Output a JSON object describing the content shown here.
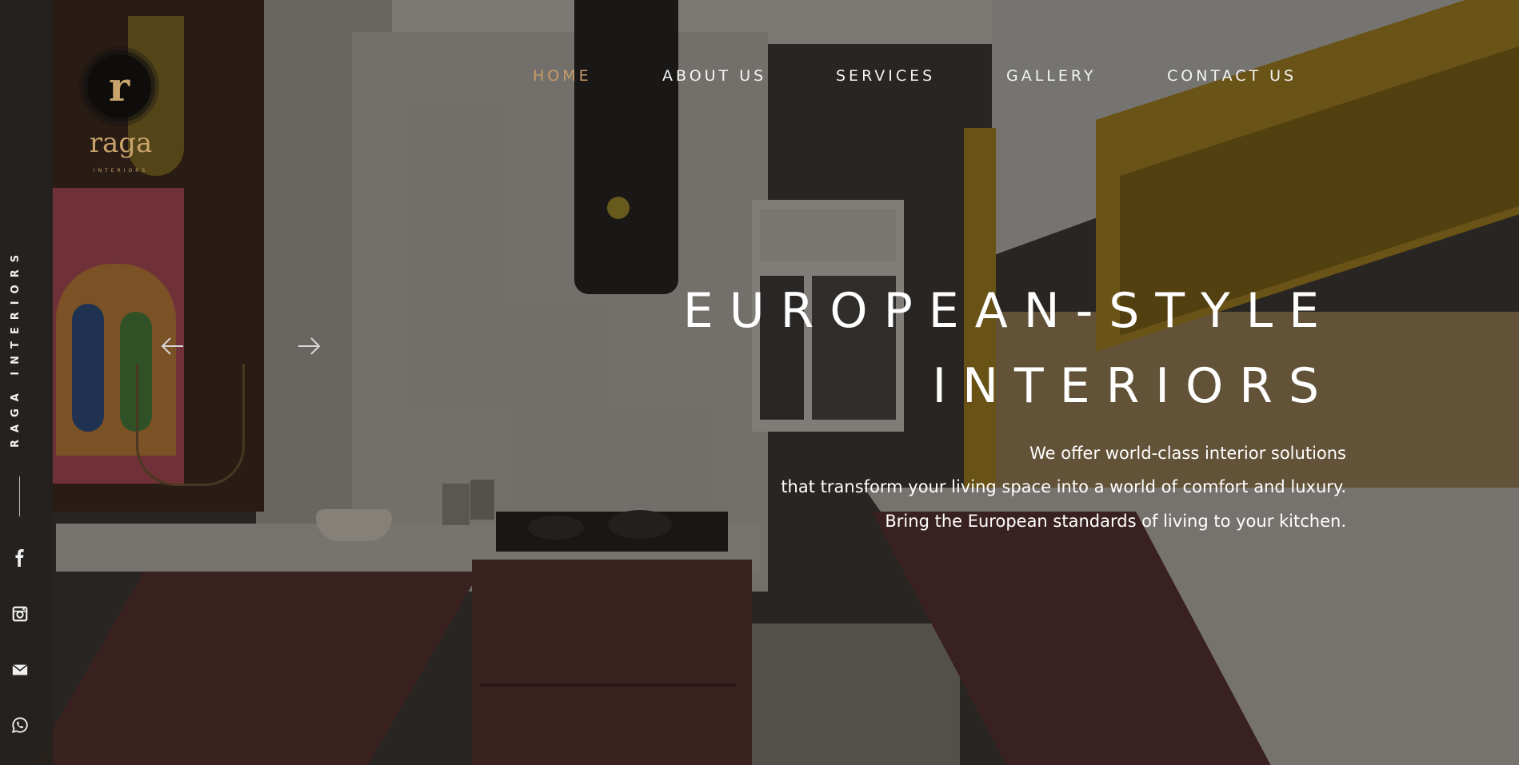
{
  "brand": {
    "logo_letter": "r",
    "logo_name": "raga",
    "logo_sub": "INTERIORS",
    "vertical_text": "RAGA INTERIORS",
    "accent_color": "#c59a6b"
  },
  "nav": {
    "items": [
      {
        "label": "HOME",
        "active": true
      },
      {
        "label": "ABOUT US",
        "active": false
      },
      {
        "label": "SERVICES",
        "active": false
      },
      {
        "label": "GALLERY",
        "active": false
      },
      {
        "label": "CONTACT US",
        "active": false
      }
    ]
  },
  "hero": {
    "title_line1": "EUROPEAN-STYLE",
    "title_line2": "INTERIORS",
    "description_lines": [
      "We offer world-class interior solutions",
      "that transform your living space into a world of comfort and luxury.",
      "Bring the European standards of living to your kitchen."
    ]
  },
  "carousel": {
    "prev_icon": "arrow-left-icon",
    "next_icon": "arrow-right-icon"
  },
  "social": [
    {
      "icon": "facebook-icon"
    },
    {
      "icon": "instagram-icon"
    },
    {
      "icon": "email-icon"
    },
    {
      "icon": "whatsapp-icon"
    }
  ]
}
